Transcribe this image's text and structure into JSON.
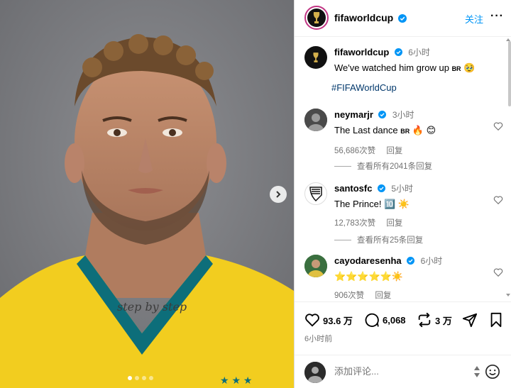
{
  "post": {
    "account": "fifaworldcup",
    "follow_label": "关注",
    "more_label": "···",
    "caption_time": "6小时",
    "caption_text": "We've watched him grow up",
    "caption_flag": "BR",
    "caption_emoji": "🥹",
    "hashtag": "#FIFAWorldCup",
    "posted_ago": "6小时前"
  },
  "comments": [
    {
      "user": "neymarjr",
      "time": "3小时",
      "text": "The Last dance",
      "flag": "BR",
      "emoji": "🔥 😊",
      "likes": "56,686次赞",
      "reply": "回复",
      "view_replies": "查看所有2041条回复"
    },
    {
      "user": "santosfc",
      "time": "5小时",
      "text": "The Prince!",
      "emoji": "🔟 ☀️",
      "likes": "12,783次赞",
      "reply": "回复",
      "view_replies": "查看所有25条回复"
    },
    {
      "user": "cayodaresenha",
      "time": "6小时",
      "text": "⭐⭐⭐⭐⭐☀️",
      "likes": "906次赞",
      "reply": "回复"
    }
  ],
  "actions": {
    "likes": "93.6 万",
    "comments": "6,068",
    "reposts": "3 万"
  },
  "add_comment": {
    "placeholder": "添加评论..."
  },
  "colors": {
    "link_blue": "#0095f6",
    "verified_blue": "#0095f6",
    "jersey_yellow": "#f5d11f",
    "collar_teal": "#0d6e7a",
    "background_gray": "#7b7c80"
  },
  "icons": [
    "verified-icon",
    "heart-icon",
    "comment-icon",
    "repost-icon",
    "share-icon",
    "bookmark-icon",
    "chevron-right-icon",
    "emoji-icon"
  ]
}
